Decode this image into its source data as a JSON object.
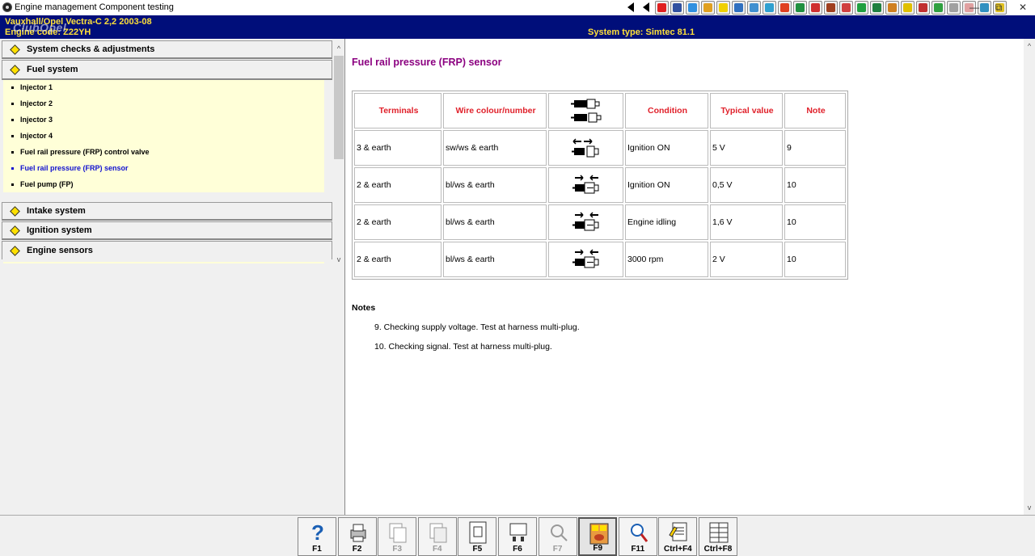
{
  "window": {
    "title": "Engine management Component testing",
    "minimize": "—",
    "restore": "⧉",
    "close": "✕"
  },
  "toolbar": {
    "icons": [
      {
        "name": "first-icon",
        "color": "#000000"
      },
      {
        "name": "back-icon",
        "color": "#000000"
      },
      {
        "name": "warning-icon",
        "color": "#e02020"
      },
      {
        "name": "engine-icon",
        "color": "#3050a0"
      },
      {
        "name": "diagram-icon",
        "color": "#3090e0"
      },
      {
        "name": "gauge-icon",
        "color": "#e0a020"
      },
      {
        "name": "tools-icon",
        "color": "#f0d000"
      },
      {
        "name": "tyre-icon",
        "color": "#3070c0"
      },
      {
        "name": "belt-icon",
        "color": "#4090d0"
      },
      {
        "name": "wiring-icon",
        "color": "#30a0d0"
      },
      {
        "name": "lift-icon",
        "color": "#e04020"
      },
      {
        "name": "sensor-icon",
        "color": "#209040"
      },
      {
        "name": "service-icon",
        "color": "#d03030"
      },
      {
        "name": "repair-icon",
        "color": "#a04020"
      },
      {
        "name": "oil-icon",
        "color": "#d04040"
      },
      {
        "name": "battery-icon",
        "color": "#20a040"
      },
      {
        "name": "lamp-icon",
        "color": "#208040"
      },
      {
        "name": "airbag-icon",
        "color": "#d08020"
      },
      {
        "name": "key-icon",
        "color": "#e0c000"
      },
      {
        "name": "fuse-icon",
        "color": "#c03030"
      },
      {
        "name": "hazard-icon",
        "color": "#30a040"
      },
      {
        "name": "coolant-icon",
        "color": "#a0a0a0"
      },
      {
        "name": "triangle-icon",
        "color": "#e0a0a0"
      },
      {
        "name": "car-icon",
        "color": "#3090c0"
      },
      {
        "name": "paint-icon",
        "color": "#e0c020"
      }
    ]
  },
  "vehicle": {
    "make_model": "Vauxhall/Opel   Vectra-C  2,2  2003-08",
    "engine_code": "Engine code: Z22YH",
    "system_type": "System type: Simtec 81.1",
    "watermark": "ClubOpel"
  },
  "nav": {
    "categories": [
      {
        "label": "System checks & adjustments"
      },
      {
        "label": "Fuel system"
      },
      {
        "label": "Intake system"
      },
      {
        "label": "Ignition system"
      },
      {
        "label": "Engine sensors"
      }
    ],
    "fuel_items": [
      {
        "label": "Injector 1",
        "active": false
      },
      {
        "label": "Injector 2",
        "active": false
      },
      {
        "label": "Injector 3",
        "active": false
      },
      {
        "label": "Injector 4",
        "active": false
      },
      {
        "label": "Fuel rail pressure (FRP) control valve",
        "active": false
      },
      {
        "label": "Fuel rail pressure (FRP) sensor",
        "active": true
      },
      {
        "label": "Fuel pump (FP)",
        "active": false
      }
    ],
    "scroll_up": "^",
    "scroll_down": "v"
  },
  "content": {
    "heading": "Fuel rail pressure (FRP) sensor",
    "table": {
      "headers": [
        "Terminals",
        "Wire colour/number",
        "connector-icon",
        "Condition",
        "Typical value",
        "Note"
      ],
      "rows": [
        {
          "terminals": "3 & earth",
          "wire": "sw/ws & earth",
          "connector": "disconnected",
          "condition": "Ignition ON",
          "value": "5 V",
          "note": "9"
        },
        {
          "terminals": "2 & earth",
          "wire": "bl/ws & earth",
          "connector": "connected",
          "condition": "Ignition ON",
          "value": "0,5 V",
          "note": "10"
        },
        {
          "terminals": "2 & earth",
          "wire": "bl/ws & earth",
          "connector": "connected",
          "condition": "Engine idling",
          "value": "1,6 V",
          "note": "10"
        },
        {
          "terminals": "2 & earth",
          "wire": "bl/ws & earth",
          "connector": "connected",
          "condition": "3000 rpm",
          "value": "2 V",
          "note": "10"
        }
      ]
    },
    "notes_label": "Notes",
    "notes": [
      "9. Checking supply voltage. Test at harness multi-plug.",
      "10. Checking signal. Test at harness multi-plug."
    ]
  },
  "function_keys": [
    {
      "label": "F1",
      "icon": "help-icon",
      "enabled": true,
      "pressed": false
    },
    {
      "label": "F2",
      "icon": "print-icon",
      "enabled": true,
      "pressed": false
    },
    {
      "label": "F3",
      "icon": "copy-icon",
      "enabled": false,
      "pressed": false
    },
    {
      "label": "F4",
      "icon": "paste-icon",
      "enabled": false,
      "pressed": false
    },
    {
      "label": "F5",
      "icon": "document-icon",
      "enabled": true,
      "pressed": false
    },
    {
      "label": "F6",
      "icon": "module-icon",
      "enabled": true,
      "pressed": false
    },
    {
      "label": "F7",
      "icon": "zoom-icon",
      "enabled": false,
      "pressed": false
    },
    {
      "label": "F9",
      "icon": "component-icon",
      "enabled": true,
      "pressed": true
    },
    {
      "label": "F11",
      "icon": "search-icon",
      "enabled": true,
      "pressed": false
    },
    {
      "label": "Ctrl+F4",
      "icon": "notes-icon",
      "enabled": true,
      "pressed": false
    },
    {
      "label": "Ctrl+F8",
      "icon": "grid-icon",
      "enabled": true,
      "pressed": false
    }
  ]
}
